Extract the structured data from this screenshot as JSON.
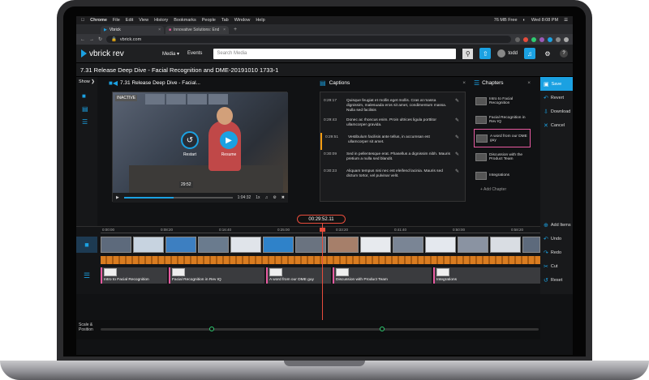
{
  "menubar": {
    "items": [
      "Chrome",
      "File",
      "Edit",
      "View",
      "History",
      "Bookmarks",
      "People",
      "Tab",
      "Window",
      "Help"
    ],
    "battery": "76 MB Free",
    "clock": "Wed 8:08 PM"
  },
  "browser": {
    "tabs": [
      {
        "label": "Vbrick"
      },
      {
        "label": "Innovative Solutions: Enduring..."
      }
    ],
    "new_tab": "+",
    "url": "vbrick.com"
  },
  "header": {
    "logo": "vbrick rev",
    "nav": [
      "Media ▾",
      "Events"
    ],
    "search_placeholder": "Search Media",
    "user": "todd"
  },
  "page_title": "7.31 Release Deep Dive - Facial Recognition and DME-20191010 1733-1",
  "left": {
    "show": "Show ❯"
  },
  "player": {
    "title": "7.31 Release Deep Dive - Facial...",
    "inactive": "INACTIVE",
    "restart": "Restart",
    "resume": "Resume",
    "tooltip": "29:52",
    "duration": "1:04:32",
    "speed": "1x",
    "progress": 0.46
  },
  "captions": {
    "title": "Captions",
    "rows": [
      {
        "time": "0:29:17",
        "text": "Quisque feugiat et mollis eget mollis. Cras at massa dignissim, malesuada eros sit amet, condimentum massa. Nulla sed facilisis"
      },
      {
        "time": "0:29:43",
        "text": "Donec ac rhoncus enim. Proin ultrices ligula porttitor ullamcorper gravida."
      },
      {
        "time": "0:29:51",
        "text": "Vestibulum facilisis ante tellus, in accumsan est ullamcorper sit amet.",
        "selected": true
      },
      {
        "time": "0:30:09",
        "text": "Sed in pellentesque erat. Phasellus a dignissim nibh. Mauris pretium a nulla sed blandit."
      },
      {
        "time": "0:30:23",
        "text": "Aliquam tempus nisi nec est eleifend lacinia. Mauris sed dictum tortor, vel pulvinar velit."
      }
    ]
  },
  "chapters": {
    "title": "Chapters",
    "items": [
      {
        "label": "Intro to Facial Recognition"
      },
      {
        "label": "Facial Recognition in Rev IQ"
      },
      {
        "label": "A word from our DME guy",
        "selected": true
      },
      {
        "label": "Discussion with the Product Team"
      },
      {
        "label": "Integrations"
      }
    ],
    "add": "+ Add Chapter"
  },
  "actions": {
    "top": [
      {
        "label": "Save",
        "icon": "save-icon"
      },
      {
        "label": "Revert",
        "icon": "revert-icon"
      },
      {
        "label": "Download",
        "icon": "download-icon"
      },
      {
        "label": "Cancel",
        "icon": "cancel-icon"
      }
    ],
    "timeline": [
      {
        "label": "Add Items",
        "icon": "add-icon"
      },
      {
        "label": "Undo",
        "icon": "undo-icon"
      },
      {
        "label": "Redo",
        "icon": "redo-icon"
      },
      {
        "label": "Cut",
        "icon": "cut-icon"
      },
      {
        "label": "Reset",
        "icon": "reset-icon"
      }
    ]
  },
  "timecode": "00:29:52.11",
  "ruler": [
    "0:00:00",
    "0:08:20",
    "0:16:40",
    "0:25:00",
    "0:33:20",
    "0:41:40",
    "0:50:00",
    "0:58:20"
  ],
  "chapter_track": [
    "Intro to Facial Recognition",
    "Facial Recognition in Rev IQ",
    "A word from our DME guy",
    "Discussion with Product Team",
    "Integrations"
  ],
  "scale": "Scale & Position",
  "colors": {
    "accent": "#1ba1e2",
    "playhead": "#e74c3c",
    "chapter": "#e85aa0",
    "audio": "#d97c20"
  }
}
